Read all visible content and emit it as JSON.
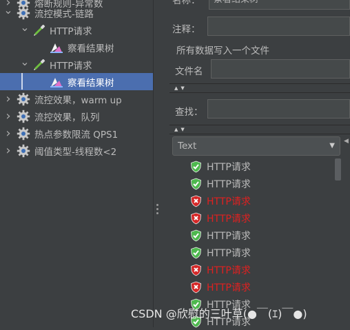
{
  "tree": {
    "nodes": [
      {
        "label": "熔断规则-异常数",
        "level": 0,
        "icon": "gear-icon",
        "expand": "collapsed"
      },
      {
        "label": "流控模式-链路",
        "level": 0,
        "icon": "gear-icon",
        "expand": "expanded"
      },
      {
        "label": "HTTP请求",
        "level": 1,
        "icon": "pipette-icon",
        "expand": "expanded"
      },
      {
        "label": "察看结果树",
        "level": 2,
        "icon": "results-tree-icon",
        "expand": "none"
      },
      {
        "label": "HTTP请求",
        "level": 1,
        "icon": "pipette-icon",
        "expand": "expanded"
      },
      {
        "label": "察看结果树",
        "level": 2,
        "icon": "results-tree-icon",
        "expand": "none",
        "selected": true
      },
      {
        "label": "流控效果，warm up",
        "level": 0,
        "icon": "gear-icon",
        "expand": "collapsed"
      },
      {
        "label": "流控效果，队列",
        "level": 0,
        "icon": "gear-icon",
        "expand": "collapsed"
      },
      {
        "label": "热点参数限流 QPS1",
        "level": 0,
        "icon": "gear-icon",
        "expand": "collapsed"
      },
      {
        "label": "阈值类型-线程数<2",
        "level": 0,
        "icon": "gear-icon",
        "expand": "collapsed"
      }
    ]
  },
  "panel": {
    "name_label": "名称：",
    "name_value": "察看结果树",
    "comment_label": "注释：",
    "write_all_label": "所有数据写入一个文件",
    "filename_label": "文件名",
    "search_label": "查找：",
    "renderer_selected": "Text"
  },
  "results": [
    {
      "label": "HTTP请求",
      "status": "success"
    },
    {
      "label": "HTTP请求",
      "status": "success"
    },
    {
      "label": "HTTP请求",
      "status": "error"
    },
    {
      "label": "HTTP请求",
      "status": "error"
    },
    {
      "label": "HTTP请求",
      "status": "success"
    },
    {
      "label": "HTTP请求",
      "status": "success"
    },
    {
      "label": "HTTP请求",
      "status": "error"
    },
    {
      "label": "HTTP请求",
      "status": "error"
    },
    {
      "label": "HTTP请求",
      "status": "success"
    },
    {
      "label": "HTTP请求",
      "status": "success"
    }
  ],
  "colors": {
    "success": "#4eb84e",
    "error": "#d42828",
    "success_text": "#bbbbbb",
    "error_text": "#e02020",
    "selection": "#4b6eaf"
  },
  "watermark": "CSDN @欣慰的三叶草(●￣(ｴ)￣●)"
}
